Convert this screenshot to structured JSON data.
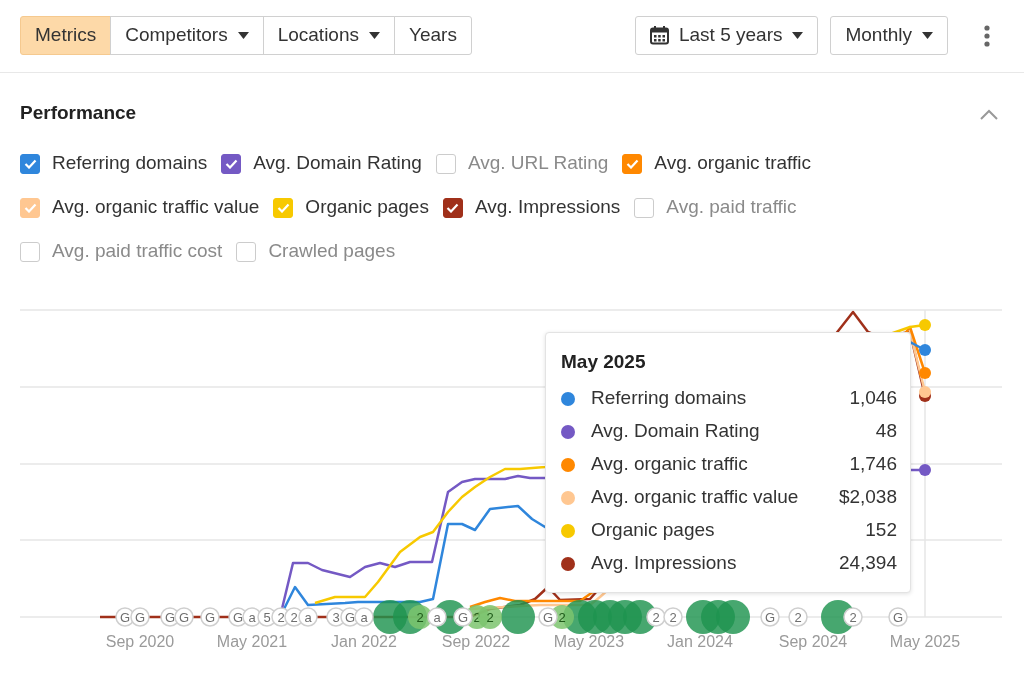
{
  "toolbar": {
    "segments": [
      {
        "label": "Metrics",
        "selected": true,
        "dropdown": false
      },
      {
        "label": "Competitors",
        "selected": false,
        "dropdown": true
      },
      {
        "label": "Locations",
        "selected": false,
        "dropdown": true
      },
      {
        "label": "Years",
        "selected": false,
        "dropdown": false
      }
    ],
    "range": "Last 5 years",
    "interval": "Monthly"
  },
  "panel": {
    "title": "Performance",
    "expanded": true
  },
  "metrics": [
    {
      "label": "Referring domains",
      "checked": true,
      "color": "#2f86dc"
    },
    {
      "label": "Avg. Domain Rating",
      "checked": true,
      "color": "#7459c4"
    },
    {
      "label": "Avg. URL Rating",
      "checked": false
    },
    {
      "label": "Avg. organic traffic",
      "checked": true,
      "color": "#ff8800"
    },
    {
      "label": "Avg. organic traffic value",
      "checked": true,
      "color": "#ffc791"
    },
    {
      "label": "Organic pages",
      "checked": true,
      "color": "#f7c900"
    },
    {
      "label": "Avg. Impressions",
      "checked": true,
      "color": "#a0301a"
    },
    {
      "label": "Avg. paid traffic",
      "checked": false
    },
    {
      "label": "Avg. paid traffic cost",
      "checked": false
    },
    {
      "label": "Crawled pages",
      "checked": false
    }
  ],
  "chart": {
    "x_labels": [
      "Sep 2020",
      "May 2021",
      "Jan 2022",
      "Sep 2022",
      "May 2023",
      "Jan 2024",
      "Sep 2024",
      "May 2025"
    ],
    "markers": [
      {
        "kind": "note",
        "text": "G"
      },
      {
        "kind": "note",
        "text": "G"
      },
      {
        "kind": "note",
        "text": "G"
      },
      {
        "kind": "note",
        "text": "G"
      },
      {
        "kind": "note",
        "text": "G"
      },
      {
        "kind": "note",
        "text": "G"
      },
      {
        "kind": "note",
        "text": "a"
      },
      {
        "kind": "note",
        "text": "5"
      },
      {
        "kind": "note",
        "text": "2"
      },
      {
        "kind": "note",
        "text": "2"
      },
      {
        "kind": "note",
        "text": "a"
      },
      {
        "kind": "note",
        "text": "3"
      },
      {
        "kind": "note",
        "text": "G"
      },
      {
        "kind": "note",
        "text": "a"
      },
      {
        "kind": "event"
      },
      {
        "kind": "event"
      },
      {
        "kind": "minor",
        "text": "2"
      },
      {
        "kind": "note",
        "text": "a"
      },
      {
        "kind": "event"
      },
      {
        "kind": "note",
        "text": "G"
      },
      {
        "kind": "minor",
        "text": "2"
      },
      {
        "kind": "minor",
        "text": "2"
      },
      {
        "kind": "event"
      },
      {
        "kind": "note",
        "text": "G"
      },
      {
        "kind": "minor",
        "text": "2"
      },
      {
        "kind": "event"
      },
      {
        "kind": "event"
      },
      {
        "kind": "event"
      },
      {
        "kind": "event"
      },
      {
        "kind": "event"
      },
      {
        "kind": "note",
        "text": "2"
      },
      {
        "kind": "note",
        "text": "2"
      },
      {
        "kind": "event"
      },
      {
        "kind": "event"
      },
      {
        "kind": "event"
      },
      {
        "kind": "note",
        "text": "G"
      },
      {
        "kind": "note",
        "text": "2"
      },
      {
        "kind": "event"
      },
      {
        "kind": "note",
        "text": "2"
      },
      {
        "kind": "note",
        "text": "G"
      }
    ]
  },
  "tooltip": {
    "title": "May 2025",
    "rows": [
      {
        "label": "Referring domains",
        "value": "1,046",
        "color": "#2f86dc"
      },
      {
        "label": "Avg. Domain Rating",
        "value": "48",
        "color": "#7459c4"
      },
      {
        "label": "Avg. organic traffic",
        "value": "1,746",
        "color": "#ff8800"
      },
      {
        "label": "Avg. organic traffic value",
        "value": "$2,038",
        "color": "#ffc791"
      },
      {
        "label": "Organic pages",
        "value": "152",
        "color": "#f7c900"
      },
      {
        "label": "Avg. Impressions",
        "value": "24,394",
        "color": "#a0301a"
      }
    ]
  }
}
